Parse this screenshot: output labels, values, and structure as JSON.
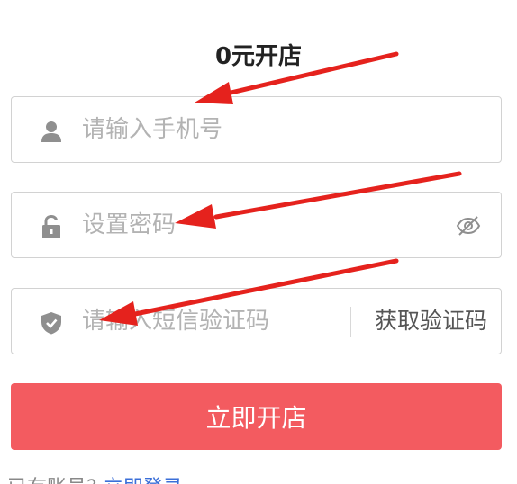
{
  "header": {
    "title": "0元开店"
  },
  "form": {
    "phone": {
      "placeholder": "请输入手机号",
      "icon": "user-icon"
    },
    "password": {
      "placeholder": "设置密码",
      "icon": "lock-icon",
      "toggle_icon": "eye-hidden-icon"
    },
    "sms": {
      "placeholder": "请输入短信验证码",
      "icon": "shield-icon",
      "get_code_label": "获取验证码"
    },
    "submit_label": "立即开店"
  },
  "footer": {
    "prompt": "已有账号?",
    "login_link": "立即登录"
  },
  "annotations": {
    "arrow_color": "#e5221d"
  },
  "colors": {
    "primary_button": "#f35b60",
    "link": "#3b6fd8"
  }
}
